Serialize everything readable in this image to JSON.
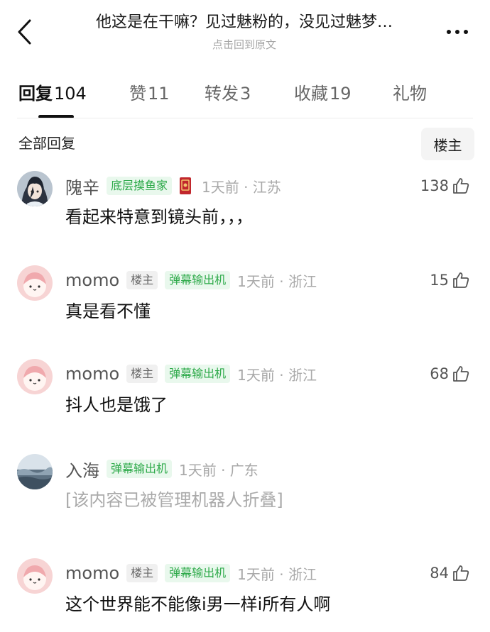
{
  "header": {
    "title": "他这是在干嘛？见过魅粉的，没见过魅梦…",
    "subtitle": "点击回到原文",
    "back_icon": "chevron-left-icon",
    "more_icon": "more-horizontal-icon"
  },
  "tabs": [
    {
      "label": "回复",
      "count": "104",
      "active": true
    },
    {
      "label": "赞",
      "count": "11"
    },
    {
      "label": "转发",
      "count": "3"
    },
    {
      "label": "收藏",
      "count": "19"
    },
    {
      "label": "礼物",
      "count": ""
    }
  ],
  "filter": {
    "all_label": "全部回复",
    "owner_label": "楼主"
  },
  "colors": {
    "badge_text": "#2eaa4a",
    "badge_bg": "#e9f8ed",
    "muted": "#a9a9a9"
  },
  "comments": [
    {
      "user": "隗辛",
      "badge": "底层摸鱼家",
      "time": "1天前 · 江苏",
      "likes": "138",
      "text": "看起来特意到镜头前，，，",
      "avatar": "anime-character-avatar",
      "medal": "red-card-medal-icon"
    },
    {
      "user": "momo",
      "owner_tag": "楼主",
      "badge": "弹幕输出机",
      "time": "1天前 · 浙江",
      "likes": "15",
      "text": "真是看不懂",
      "avatar": "pink-cartoon-avatar"
    },
    {
      "user": "momo",
      "owner_tag": "楼主",
      "badge": "弹幕输出机",
      "time": "1天前 · 浙江",
      "likes": "68",
      "text": "抖人也是饿了",
      "avatar": "pink-cartoon-avatar"
    },
    {
      "user": "入海",
      "badge": "弹幕输出机",
      "time": "1天前 · 广东",
      "likes": "",
      "text": "[该内容已被管理机器人折叠]",
      "avatar": "sea-landscape-avatar"
    },
    {
      "user": "momo",
      "owner_tag": "楼主",
      "badge": "弹幕输出机",
      "time": "1天前 · 浙江",
      "likes": "84",
      "text": "这个世界能不能像i男一样i所有人啊",
      "avatar": "pink-cartoon-avatar"
    }
  ]
}
